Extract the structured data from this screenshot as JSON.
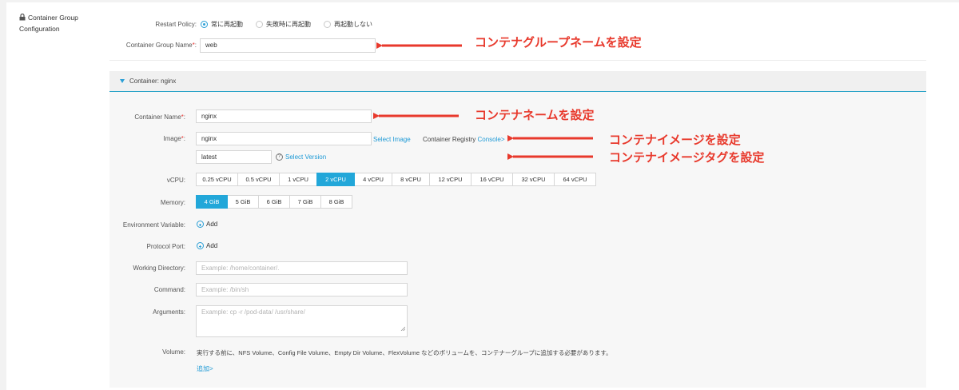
{
  "section": {
    "title": "Container Group Configuration"
  },
  "restart_policy": {
    "label": "Restart Policy:",
    "options": [
      "常に再起動",
      "失敗時に再起動",
      "再起動しない"
    ],
    "selected_index": 0
  },
  "group_name": {
    "label": "Container Group Name",
    "value": "web"
  },
  "container_panel": {
    "title": "Container: nginx"
  },
  "container_name": {
    "label": "Container Name",
    "value": "nginx"
  },
  "image": {
    "label": "Image",
    "value": "nginx",
    "select_image": "Select Image",
    "registry_label": "Container Registry",
    "console_link": "Console>",
    "tag_value": "latest",
    "select_version": "Select Version"
  },
  "vcpu": {
    "label": "vCPU:",
    "options": [
      "0.25 vCPU",
      "0.5 vCPU",
      "1 vCPU",
      "2 vCPU",
      "4 vCPU",
      "8 vCPU",
      "12 vCPU",
      "16 vCPU",
      "32 vCPU",
      "64 vCPU"
    ],
    "selected": "2 vCPU"
  },
  "memory": {
    "label": "Memory:",
    "options": [
      "4 GiB",
      "5 GiB",
      "6 GiB",
      "7 GiB",
      "8 GiB"
    ],
    "selected": "4 GiB"
  },
  "env_var": {
    "label": "Environment Variable:",
    "add": "Add"
  },
  "protocol_port": {
    "label": "Protocol Port:",
    "add": "Add"
  },
  "working_dir": {
    "label": "Working Directory:",
    "placeholder": "Example: /home/container/."
  },
  "command": {
    "label": "Command:",
    "placeholder": "Example: /bin/sh"
  },
  "arguments": {
    "label": "Arguments:",
    "placeholder": "Example: cp -r /pod-data/ /usr/share/"
  },
  "volume": {
    "label": "Volume:",
    "text": "実行する前に、NFS Volume、Config File Volume、Empty Dir Volume、FlexVolume などのボリュームを、コンテナーグループに追加する必要があります。",
    "add_link": "追加>"
  },
  "annotations": {
    "group_name": "コンテナグループネームを設定",
    "container_name": "コンテナネームを設定",
    "image": "コンテナイメージを設定",
    "image_tag": "コンテナイメージタグを設定"
  },
  "colors": {
    "accent": "#22a7d9",
    "annotation": "#e8392c"
  }
}
